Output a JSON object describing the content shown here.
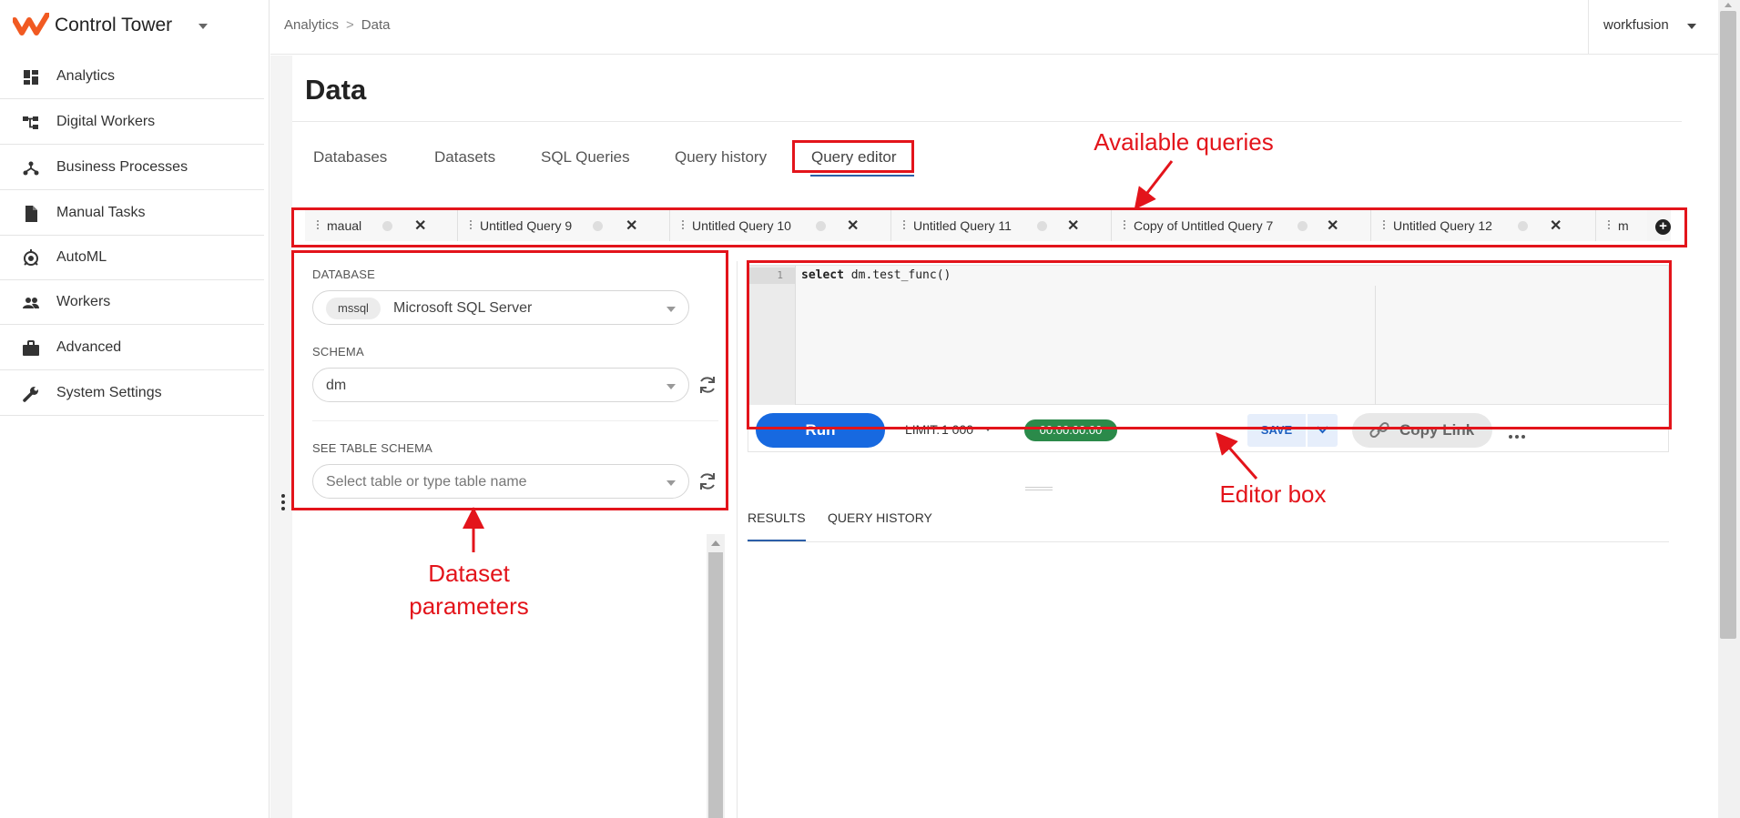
{
  "app": {
    "title": "Control Tower"
  },
  "sidebar": {
    "items": [
      {
        "label": "Analytics",
        "icon": "dashboard-icon"
      },
      {
        "label": "Digital Workers",
        "icon": "workers-tree-icon"
      },
      {
        "label": "Business Processes",
        "icon": "process-icon"
      },
      {
        "label": "Manual Tasks",
        "icon": "document-icon"
      },
      {
        "label": "AutoML",
        "icon": "automl-icon"
      },
      {
        "label": "Workers",
        "icon": "people-icon"
      },
      {
        "label": "Advanced",
        "icon": "briefcase-icon"
      },
      {
        "label": "System Settings",
        "icon": "wrench-icon"
      }
    ]
  },
  "breadcrumb": {
    "parent": "Analytics",
    "separator": ">",
    "current": "Data"
  },
  "user": {
    "name": "workfusion"
  },
  "page": {
    "title": "Data"
  },
  "tabs": {
    "databases": "Databases",
    "datasets": "Datasets",
    "sql_queries": "SQL Queries",
    "query_history": "Query history",
    "query_editor": "Query editor",
    "active": "Query editor"
  },
  "query_tabs": [
    {
      "name": "maual"
    },
    {
      "name": "Untitled Query 9"
    },
    {
      "name": "Untitled Query 10"
    },
    {
      "name": "Untitled Query 11"
    },
    {
      "name": "Copy of Untitled Query 7"
    },
    {
      "name": "Untitled Query 12"
    },
    {
      "name": "m"
    }
  ],
  "params": {
    "database_label": "DATABASE",
    "database_chip": "mssql",
    "database_value": "Microsoft SQL Server",
    "schema_label": "SCHEMA",
    "schema_value": "dm",
    "table_schema_label": "SEE TABLE SCHEMA",
    "table_placeholder": "Select table or type table name"
  },
  "editor": {
    "line_number": "1",
    "keyword": "select",
    "code_rest": " dm.test_func()"
  },
  "toolbar": {
    "run_label": "Run",
    "limit_label": "LIMIT:",
    "limit_value": "1 000",
    "timer": "00:00:00.00",
    "save_label": "SAVE",
    "copy_link_label": "Copy Link"
  },
  "results_tabs": {
    "results": "RESULTS",
    "query_history": "QUERY HISTORY",
    "active": "RESULTS"
  },
  "annotations": {
    "available_queries": "Available queries",
    "editor_box": "Editor box",
    "dataset_line1": "Dataset",
    "dataset_line2": "parameters"
  },
  "colors": {
    "brand": "#f15a22",
    "accent": "#1769e0",
    "timer": "#2b8a4a",
    "annotation": "#e3141b"
  }
}
